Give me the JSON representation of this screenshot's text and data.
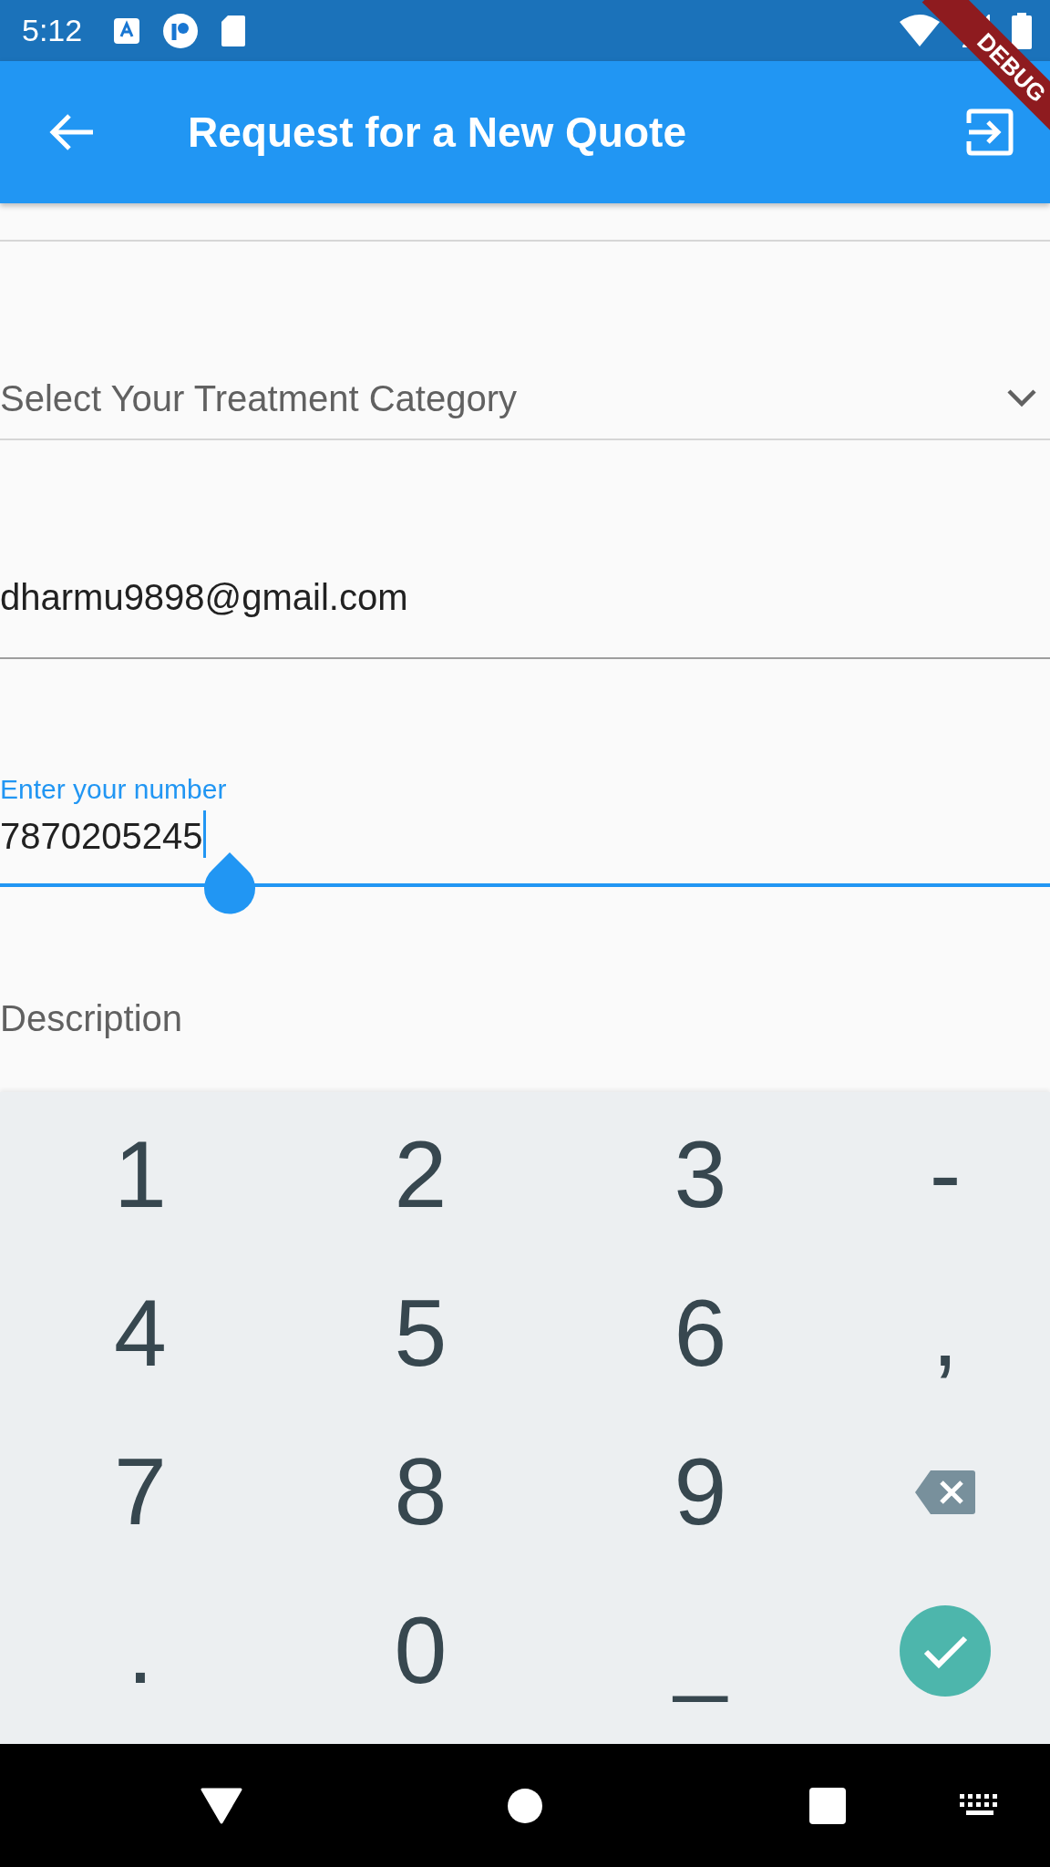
{
  "status_bar": {
    "time": "5:12"
  },
  "debug_banner": "DEBUG",
  "app_bar": {
    "title": "Request for a New Quote"
  },
  "fields": [
    {
      "kind": "dropdown",
      "placeholder": "Select Your Treatment Category",
      "focused": false
    },
    {
      "kind": "text",
      "value": "dharmu9898@gmail.com",
      "focused": false
    },
    {
      "kind": "text",
      "label": "Enter your number",
      "value": "7870205245",
      "focused": true
    },
    {
      "kind": "text",
      "placeholder": "Description",
      "focused": false
    }
  ],
  "keyboard": {
    "keys": [
      {
        "kind": "char",
        "label": "1"
      },
      {
        "kind": "char",
        "label": "2"
      },
      {
        "kind": "char",
        "label": "3"
      },
      {
        "kind": "char",
        "label": "-"
      },
      {
        "kind": "char",
        "label": "4"
      },
      {
        "kind": "char",
        "label": "5"
      },
      {
        "kind": "char",
        "label": "6"
      },
      {
        "kind": "char",
        "label": ","
      },
      {
        "kind": "char",
        "label": "7"
      },
      {
        "kind": "char",
        "label": "8"
      },
      {
        "kind": "char",
        "label": "9"
      },
      {
        "kind": "backspace"
      },
      {
        "kind": "char",
        "label": "."
      },
      {
        "kind": "char",
        "label": "0"
      },
      {
        "kind": "char",
        "label": "_"
      },
      {
        "kind": "enter"
      }
    ]
  }
}
